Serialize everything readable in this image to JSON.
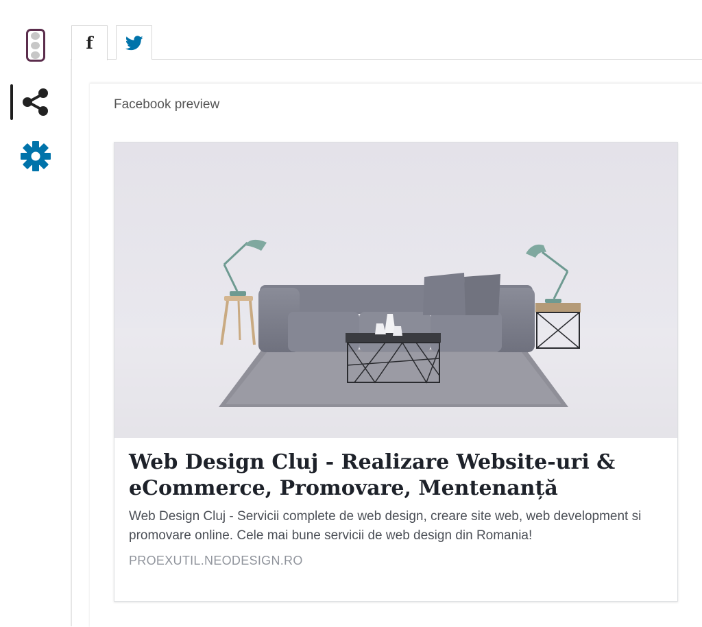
{
  "tabs": {
    "facebook_icon": "facebook-icon",
    "twitter_icon": "twitter-icon"
  },
  "sidebar": {
    "items": [
      {
        "icon": "traffic-light-icon"
      },
      {
        "icon": "share-icon"
      },
      {
        "icon": "gear-icon"
      }
    ]
  },
  "preview": {
    "heading": "Facebook preview",
    "card": {
      "title": "Web Design Cluj - Realizare Website-uri & eCommerce, Promovare, Mentenanță",
      "description": "Web Design Cluj - Servicii complete de web design, creare site web, web development si promovare online. Cele mai bune servicii de web design din Romania!",
      "domain": "PROEXUTIL.NEODESIGN.RO"
    }
  },
  "colors": {
    "accent_blue": "#0073aa",
    "seo_border": "#5b2d4c",
    "twitter_blue": "#0073aa"
  }
}
